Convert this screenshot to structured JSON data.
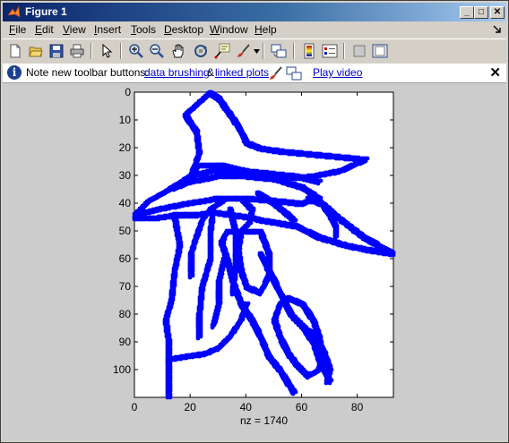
{
  "window": {
    "title": "Figure 1",
    "controls": {
      "minimize": "_",
      "maximize": "□",
      "close": "✕"
    }
  },
  "menubar": {
    "items": [
      {
        "key": "F",
        "rest": "ile"
      },
      {
        "key": "E",
        "rest": "dit"
      },
      {
        "key": "V",
        "rest": "iew"
      },
      {
        "key": "I",
        "rest": "nsert"
      },
      {
        "key": "T",
        "rest": "ools"
      },
      {
        "key": "D",
        "rest": "esktop"
      },
      {
        "key": "W",
        "rest": "indow"
      },
      {
        "key": "H",
        "rest": "elp"
      }
    ]
  },
  "toolbar": {
    "icons": [
      "new-figure-icon",
      "open-file-icon",
      "save-icon",
      "print-icon",
      "select-arrow-icon",
      "zoom-in-icon",
      "zoom-out-icon",
      "pan-hand-icon",
      "rotate-3d-icon",
      "data-cursor-icon",
      "brush-icon",
      "link-plot-icon",
      "colorbar-icon",
      "legend-icon",
      "hide-plot-tools-icon",
      "show-plot-tools-icon"
    ]
  },
  "notification": {
    "text": "Note new toolbar buttons:",
    "link1": "data brushing",
    "amp": "&",
    "link2": "linked plots",
    "link3": "Play video"
  },
  "colors": {
    "marker": "#0000ff",
    "title_gradient_start": "#0a246a",
    "title_gradient_end": "#a6caf0",
    "figure_bg": "#cccccc"
  },
  "chart_data": {
    "type": "scatter",
    "xlabel": "nz = 1740",
    "xlim": [
      0,
      93
    ],
    "ylim": [
      0,
      110
    ],
    "y_reversed": true,
    "xticks": [
      0,
      20,
      40,
      60,
      80
    ],
    "yticks": [
      0,
      10,
      20,
      30,
      40,
      50,
      60,
      70,
      80,
      90,
      100
    ],
    "outline_strokes": [
      [
        [
          18,
          8
        ],
        [
          27,
          0
        ],
        [
          30,
          2
        ],
        [
          37,
          12
        ],
        [
          40,
          18
        ],
        [
          45,
          20
        ],
        [
          52,
          21
        ],
        [
          62,
          22
        ],
        [
          73,
          23
        ],
        [
          83,
          24
        ],
        [
          74,
          28
        ],
        [
          64,
          30
        ],
        [
          52,
          31
        ],
        [
          45,
          30
        ],
        [
          39,
          28
        ],
        [
          31,
          26
        ],
        [
          23,
          26
        ],
        [
          20,
          30
        ]
      ],
      [
        [
          20,
          30
        ],
        [
          23,
          22
        ],
        [
          22,
          14
        ],
        [
          18,
          8
        ]
      ],
      [
        [
          20,
          30
        ],
        [
          12,
          35
        ],
        [
          5,
          39
        ],
        [
          0,
          44
        ],
        [
          8,
          42
        ],
        [
          18,
          40
        ],
        [
          30,
          38
        ],
        [
          40,
          38
        ],
        [
          52,
          39
        ],
        [
          60,
          40
        ],
        [
          65,
          38
        ],
        [
          73,
          45
        ],
        [
          82,
          52
        ],
        [
          93,
          58
        ],
        [
          86,
          57
        ],
        [
          76,
          55
        ],
        [
          66,
          52
        ],
        [
          58,
          48
        ],
        [
          52,
          47
        ],
        [
          46,
          46
        ],
        [
          42,
          45
        ],
        [
          35,
          44
        ],
        [
          28,
          43
        ],
        [
          22,
          44
        ],
        [
          15,
          44
        ],
        [
          8,
          45
        ],
        [
          0,
          45
        ]
      ],
      [
        [
          12,
          35
        ],
        [
          20,
          32
        ],
        [
          30,
          30
        ],
        [
          40,
          30
        ],
        [
          50,
          31
        ],
        [
          60,
          34
        ],
        [
          66,
          38
        ]
      ],
      [
        [
          20,
          30
        ],
        [
          28,
          28
        ],
        [
          38,
          28
        ],
        [
          48,
          29
        ],
        [
          58,
          30
        ],
        [
          66,
          32
        ]
      ],
      [
        [
          14,
          44
        ],
        [
          16,
          55
        ],
        [
          14,
          65
        ],
        [
          13,
          75
        ],
        [
          11,
          82
        ],
        [
          12,
          90
        ],
        [
          12,
          100
        ],
        [
          12,
          110
        ]
      ],
      [
        [
          28,
          42
        ],
        [
          27,
          50
        ],
        [
          27,
          60
        ],
        [
          24,
          70
        ],
        [
          23,
          80
        ],
        [
          23,
          88
        ]
      ],
      [
        [
          27,
          42
        ],
        [
          33,
          38
        ],
        [
          38,
          38
        ],
        [
          42,
          42
        ],
        [
          41,
          47
        ],
        [
          38,
          50
        ],
        [
          33,
          50
        ],
        [
          31,
          54
        ],
        [
          33,
          60
        ],
        [
          35,
          68
        ],
        [
          38,
          76
        ],
        [
          42,
          82
        ],
        [
          45,
          88
        ],
        [
          48,
          95
        ],
        [
          52,
          100
        ],
        [
          57,
          108
        ]
      ],
      [
        [
          38,
          50
        ],
        [
          45,
          50
        ],
        [
          48,
          58
        ],
        [
          48,
          66
        ],
        [
          45,
          72
        ],
        [
          40,
          70
        ],
        [
          38,
          64
        ],
        [
          37,
          57
        ],
        [
          38,
          50
        ]
      ],
      [
        [
          45,
          58
        ],
        [
          49,
          66
        ],
        [
          53,
          74
        ],
        [
          56,
          80
        ],
        [
          60,
          84
        ],
        [
          64,
          90
        ],
        [
          66,
          96
        ],
        [
          68,
          100
        ],
        [
          70,
          104
        ]
      ],
      [
        [
          55,
          74
        ],
        [
          60,
          76
        ],
        [
          64,
          82
        ],
        [
          66,
          88
        ],
        [
          67,
          94
        ],
        [
          66,
          100
        ],
        [
          62,
          102
        ],
        [
          58,
          98
        ],
        [
          55,
          94
        ],
        [
          52,
          88
        ],
        [
          50,
          82
        ],
        [
          52,
          76
        ],
        [
          55,
          74
        ]
      ],
      [
        [
          60,
          84
        ],
        [
          65,
          88
        ],
        [
          68,
          94
        ],
        [
          70,
          100
        ],
        [
          69,
          104
        ]
      ],
      [
        [
          40,
          76
        ],
        [
          38,
          82
        ],
        [
          34,
          88
        ],
        [
          30,
          92
        ],
        [
          25,
          94
        ],
        [
          18,
          95
        ],
        [
          12,
          96
        ]
      ],
      [
        [
          27,
          42
        ],
        [
          24,
          46
        ],
        [
          22,
          52
        ],
        [
          20,
          58
        ],
        [
          20,
          66
        ]
      ],
      [
        [
          34,
          42
        ],
        [
          36,
          50
        ],
        [
          36,
          62
        ],
        [
          35,
          72
        ]
      ],
      [
        [
          62,
          38
        ],
        [
          67,
          40
        ],
        [
          70,
          44
        ],
        [
          72,
          48
        ],
        [
          72,
          52
        ]
      ],
      [
        [
          44,
          36
        ],
        [
          50,
          40
        ],
        [
          55,
          44
        ],
        [
          57,
          46
        ]
      ],
      [
        [
          32,
          60
        ],
        [
          30,
          68
        ],
        [
          30,
          76
        ],
        [
          28,
          84
        ]
      ]
    ]
  }
}
